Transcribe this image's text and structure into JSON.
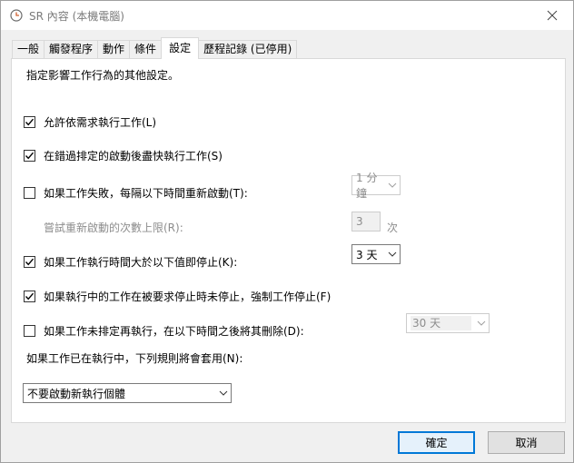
{
  "window": {
    "title": "SR 內容 (本機電腦)"
  },
  "tabs": [
    {
      "label": "一般"
    },
    {
      "label": "觸發程序"
    },
    {
      "label": "動作"
    },
    {
      "label": "條件"
    },
    {
      "label": "設定"
    },
    {
      "label": "歷程記錄 (已停用)"
    }
  ],
  "active_tab": "設定",
  "settings": {
    "description": "指定影響工作行為的其他設定。",
    "allow_on_demand": {
      "label": "允許依需求執行工作(L)",
      "checked": true
    },
    "run_after_missed": {
      "label": "在錯過排定的啟動後盡快執行工作(S)",
      "checked": true
    },
    "restart_on_fail": {
      "label": "如果工作失敗，每隔以下時間重新啟動(T):",
      "checked": false,
      "interval": "1 分鐘"
    },
    "restart_attempts": {
      "label": "嘗試重新啟動的次數上限(R):",
      "value": "3",
      "unit": "次"
    },
    "stop_if_runs_longer": {
      "label": "如果工作執行時間大於以下值即停止(K):",
      "checked": true,
      "duration": "3 天"
    },
    "force_stop": {
      "label": "如果執行中的工作在被要求停止時未停止，強制工作停止(F)",
      "checked": true
    },
    "delete_if_not_scheduled": {
      "label": "如果工作未排定再執行，在以下時間之後將其刪除(D):",
      "checked": false,
      "duration": "30 天"
    },
    "running_rule": {
      "label": "如果工作已在執行中，下列規則將會套用(N):",
      "value": "不要啟動新執行個體"
    }
  },
  "buttons": {
    "ok": "確定",
    "cancel": "取消"
  },
  "colors": {
    "accent": "#0078d7",
    "disabled_text": "#8d8d8d"
  }
}
